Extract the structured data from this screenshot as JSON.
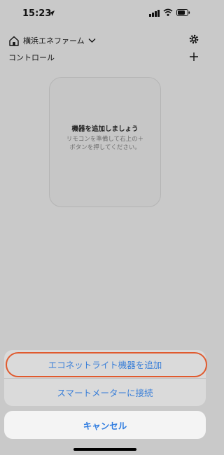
{
  "status_bar": {
    "time": "15:23"
  },
  "header": {
    "home_name": "横浜エネファーム"
  },
  "section": {
    "title": "コントロール"
  },
  "empty_state": {
    "title": "機器を追加しましょう",
    "description": "リモコンを準備して右上の＋ボタンを押してください。"
  },
  "action_sheet": {
    "items": [
      {
        "label": "エコネットライト機器を追加"
      },
      {
        "label": "スマートメーターに接続"
      }
    ],
    "cancel_label": "キャンセル"
  },
  "colors": {
    "accent_text": "#3a7fd8",
    "highlight_ring": "#e05a2e",
    "overlay": "#c9c9c9"
  }
}
